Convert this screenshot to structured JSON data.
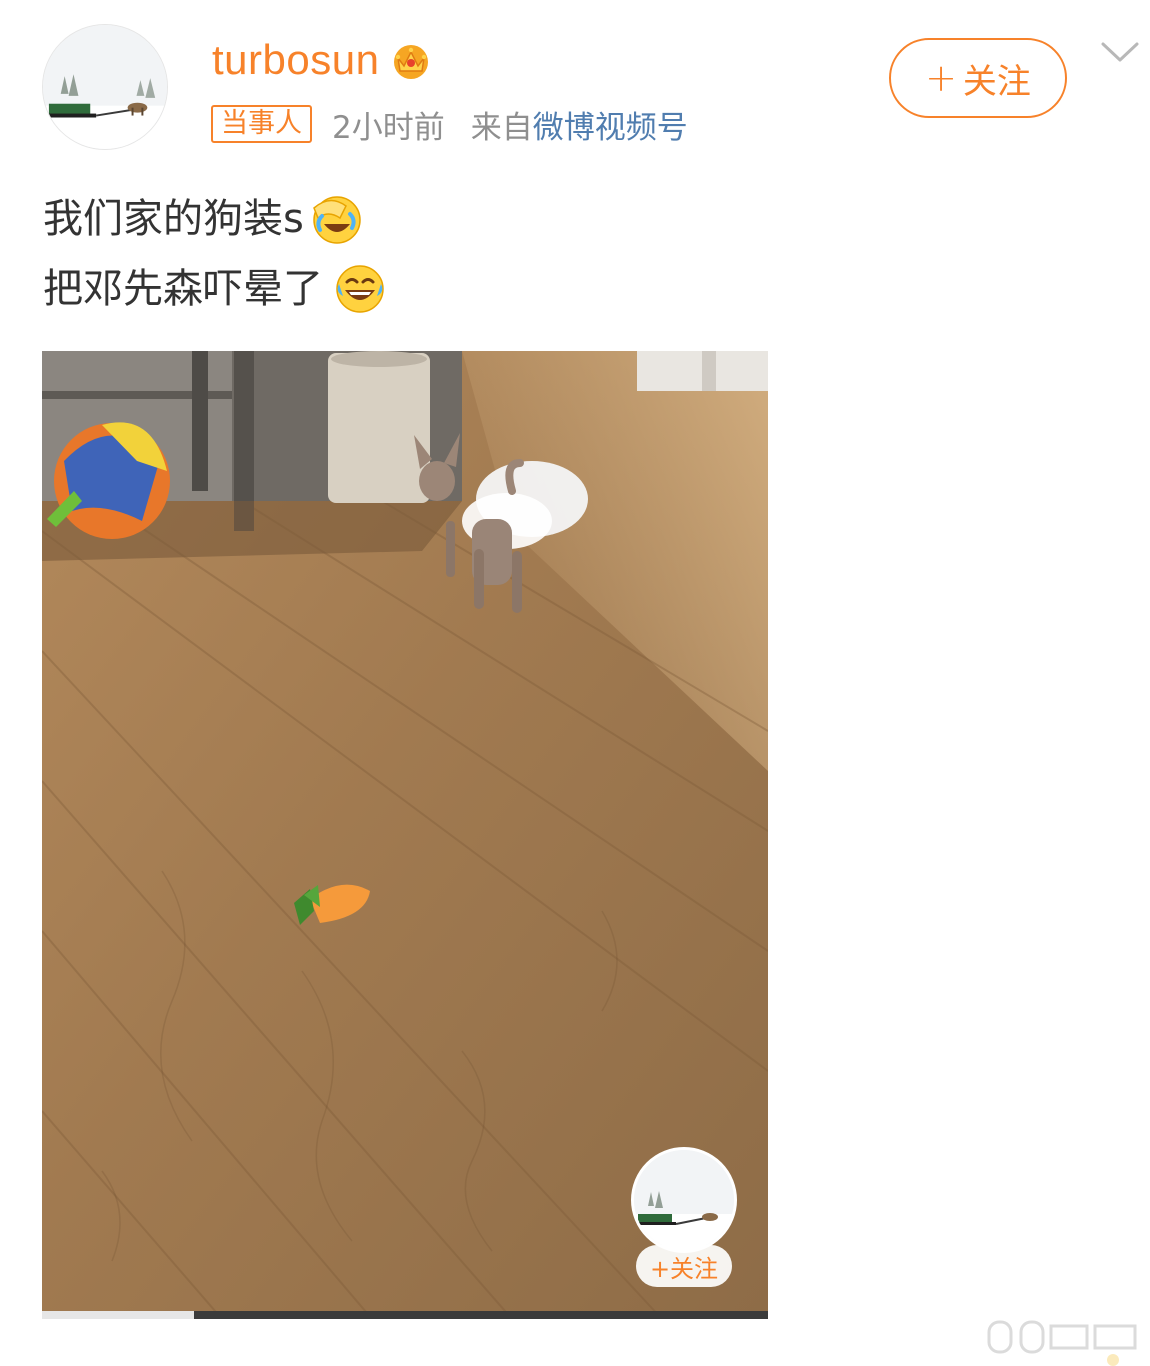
{
  "author": {
    "username": "turbosun",
    "vip_icon": "crown-icon",
    "badge": "当事人",
    "time": "2小时前",
    "from_prefix": "来自",
    "source": "微博视频号"
  },
  "actions": {
    "follow_plus": "+",
    "follow_label": "关注",
    "menu_icon": "chevron-down-icon"
  },
  "post": {
    "line1": "我们家的狗装s",
    "line1_emoji": "facepalm-laugh-emoji",
    "line2": "把邓先森吓晕了",
    "line2_emoji": "tears-of-joy-emoji"
  },
  "video": {
    "progress": 0.21,
    "overlay_follow": "+关注"
  },
  "colors": {
    "brand_orange": "#f7822a",
    "link_blue": "#507daf",
    "meta_gray": "#8f8f8f"
  }
}
